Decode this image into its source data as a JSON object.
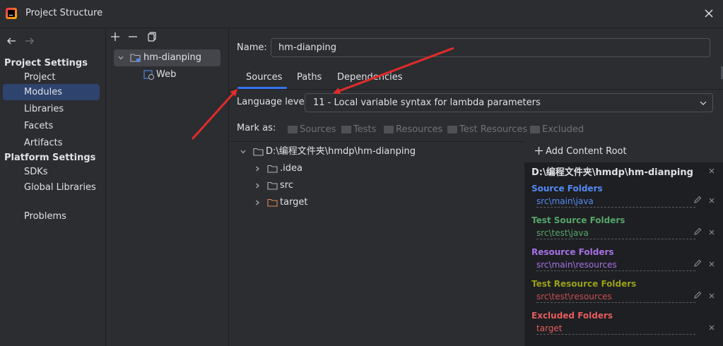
{
  "window": {
    "title": "Project Structure"
  },
  "nav": {
    "sections": [
      {
        "title": "Project Settings",
        "items": [
          "Project",
          "Modules",
          "Libraries",
          "Facets",
          "Artifacts"
        ]
      },
      {
        "title": "Platform Settings",
        "items": [
          "SDKs",
          "Global Libraries"
        ]
      }
    ],
    "problems": "Problems",
    "selected": "Modules"
  },
  "modules": {
    "root": "hm-dianping",
    "child": "Web"
  },
  "main": {
    "name_label": "Name:",
    "name_value": "hm-dianping",
    "tabs": [
      "Sources",
      "Paths",
      "Dependencies"
    ],
    "active_tab": "Sources",
    "language_label": "Language level:",
    "language_value": "11 - Local variable syntax for lambda parameters",
    "mark_as_label": "Mark as:",
    "mark_as": [
      "Sources",
      "Tests",
      "Resources",
      "Test Resources",
      "Excluded"
    ]
  },
  "tree": {
    "root": "D:\\编程文件夹\\hmdp\\hm-dianping",
    "children": [
      ".idea",
      "src",
      "target"
    ],
    "colors": {
      "folder": "#aeb3bb",
      "excluded_folder": "#e08855"
    }
  },
  "content_roots": {
    "add_label": "Add Content Root",
    "root_path": "D:\\编程文件夹\\hmdp\\hm-dianping",
    "groups": [
      {
        "title": "Source Folders",
        "path": "src\\main\\java",
        "color": "#548af7",
        "editable": true
      },
      {
        "title": "Test Source Folders",
        "path": "src\\test\\java",
        "color": "#55a76a",
        "editable": true
      },
      {
        "title": "Resource Folders",
        "path": "src\\main\\resources",
        "color": "#a571e6",
        "editable": true
      },
      {
        "title": "Test Resource Folders",
        "path": "src\\test\\resources",
        "color": "#c94f4f",
        "title_color": "#9aa01a",
        "editable": true
      },
      {
        "title": "Excluded Folders",
        "path": "target",
        "color": "#e55c5c",
        "editable": false
      }
    ]
  },
  "colors": {
    "accent": "#3574f0",
    "selected_nav": "#2e436e",
    "annotation_arrow": "#e22b2b"
  }
}
